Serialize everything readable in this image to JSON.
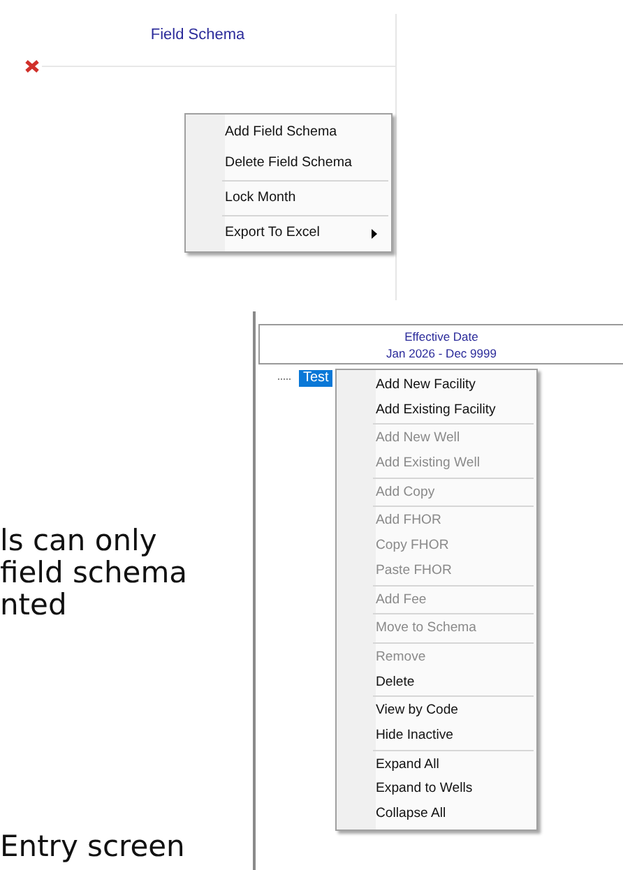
{
  "field_schema_panel": {
    "title": "Field Schema",
    "context_menu": {
      "groups": [
        [
          {
            "label": "Add Field Schema",
            "disabled": false,
            "submenu": false
          },
          {
            "label": "Delete Field Schema",
            "disabled": false,
            "submenu": false
          }
        ],
        [
          {
            "label": "Lock Month",
            "disabled": false,
            "submenu": false
          }
        ],
        [
          {
            "label": "Export To Excel",
            "disabled": false,
            "submenu": true
          }
        ]
      ]
    }
  },
  "tree_panel": {
    "header": [
      "Effective Date",
      "Jan 2026 - Dec 9999"
    ],
    "tree": [
      {
        "label": "Test",
        "selected": true
      }
    ],
    "context_menu": {
      "groups": [
        [
          {
            "label": "Add New Facility",
            "disabled": false,
            "submenu": false
          },
          {
            "label": "Add Existing Facility",
            "disabled": false,
            "submenu": false
          }
        ],
        [
          {
            "label": "Add New Well",
            "disabled": true,
            "submenu": false
          },
          {
            "label": "Add Existing Well",
            "disabled": true,
            "submenu": false
          }
        ],
        [
          {
            "label": "Add Copy",
            "disabled": true,
            "submenu": false
          }
        ],
        [
          {
            "label": "Add FHOR",
            "disabled": true,
            "submenu": false
          },
          {
            "label": "Copy FHOR",
            "disabled": true,
            "submenu": false
          },
          {
            "label": "Paste FHOR",
            "disabled": true,
            "submenu": false
          }
        ],
        [
          {
            "label": "Add Fee",
            "disabled": true,
            "submenu": false
          }
        ],
        [
          {
            "label": "Move to Schema",
            "disabled": true,
            "submenu": false
          }
        ],
        [
          {
            "label": "Remove",
            "disabled": true,
            "submenu": false
          },
          {
            "label": "Delete",
            "disabled": false,
            "submenu": false
          }
        ],
        [
          {
            "label": "View by Code",
            "disabled": false,
            "submenu": false
          },
          {
            "label": "Hide Inactive",
            "disabled": false,
            "submenu": false
          }
        ],
        [
          {
            "label": "Expand All",
            "disabled": false,
            "submenu": false
          },
          {
            "label": "Expand to Wells",
            "disabled": false,
            "submenu": false
          },
          {
            "label": "Collapse All",
            "disabled": false,
            "submenu": false
          }
        ]
      ]
    }
  },
  "body_text": {
    "lines": [
      "ls can only",
      "field schema",
      "nted"
    ],
    "last_line": "Entry screen"
  }
}
